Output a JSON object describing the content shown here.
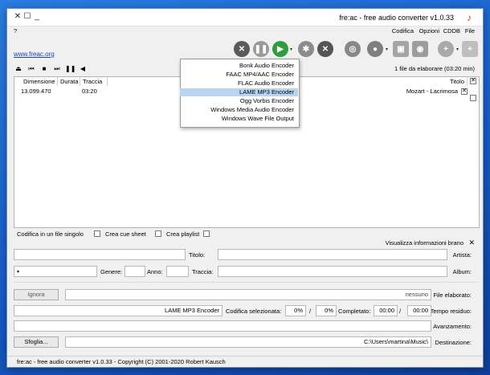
{
  "window": {
    "title": "fre:ac - free audio converter v1.0.33",
    "controls": {
      "close": "✕",
      "maximize": "☐",
      "minimize": "_"
    }
  },
  "menu": {
    "items": [
      "File",
      "CDDB",
      "Opzioni",
      "Codifica"
    ],
    "help": "?"
  },
  "toolbar": {
    "link": "www.freac.org",
    "caret": "▾"
  },
  "encoder_menu": {
    "items": [
      "Bonk Audio Encoder",
      "FAAC MP4/AAC Encoder",
      "FLAC Audio Encoder",
      "LAME MP3 Encoder",
      "Ogg Vorbis Encoder",
      "Windows Media Audio Encoder",
      "Windows Wave File Output"
    ],
    "selected": "LAME MP3 Encoder"
  },
  "info": {
    "files_to_process": "1 file da elaborare (03:20 min)"
  },
  "track_list": {
    "headers": {
      "title": "Titolo",
      "track": "Traccia",
      "duration": "Durata",
      "size": "Dimensione"
    },
    "rows": [
      {
        "title": "Mozart - Lacrimosa",
        "duration": "03:20",
        "size": "13.099.470"
      }
    ]
  },
  "options": {
    "create_playlist": "Crea playlist",
    "create_cue": "Crea cue sheet",
    "single_file": "Codifica in un file singolo",
    "show_info": "Visualizza informazioni brano"
  },
  "fields": {
    "artist_label": "Artista:",
    "title_label": "Titolo:",
    "album_label": "Album:",
    "track_label": "Traccia:",
    "year_label": "Anno:",
    "genre_label": "Genere:"
  },
  "progress": {
    "file_label": "File elaborato:",
    "file_value": "nessuno",
    "ignore_button": "Ignora",
    "time_label": "Tempo residuo:",
    "time_value": "00:00",
    "completed_label": "Completato:",
    "completed_value": "00:00",
    "percent_value": "0%",
    "slash": "/",
    "percent2_value": "0%",
    "encoder_label": "Codifica selezionata:",
    "encoder_value": "LAME MP3 Encoder",
    "advance_label": "Avanzamento:",
    "dest_label": "Destinazione:",
    "dest_value": "C:\\Users\\martina\\Music\\",
    "browse_button": "Sfoglia..."
  },
  "status": {
    "text": "fre:ac - free audio converter v1.0.33 - Copyright (C) 2001-2020 Robert Kausch"
  },
  "colors": {
    "accent": "#1a3fc7",
    "selection": "#b8d4f0",
    "play_green": "#2e9e3c",
    "stop_gray": "#8a8a8a"
  }
}
